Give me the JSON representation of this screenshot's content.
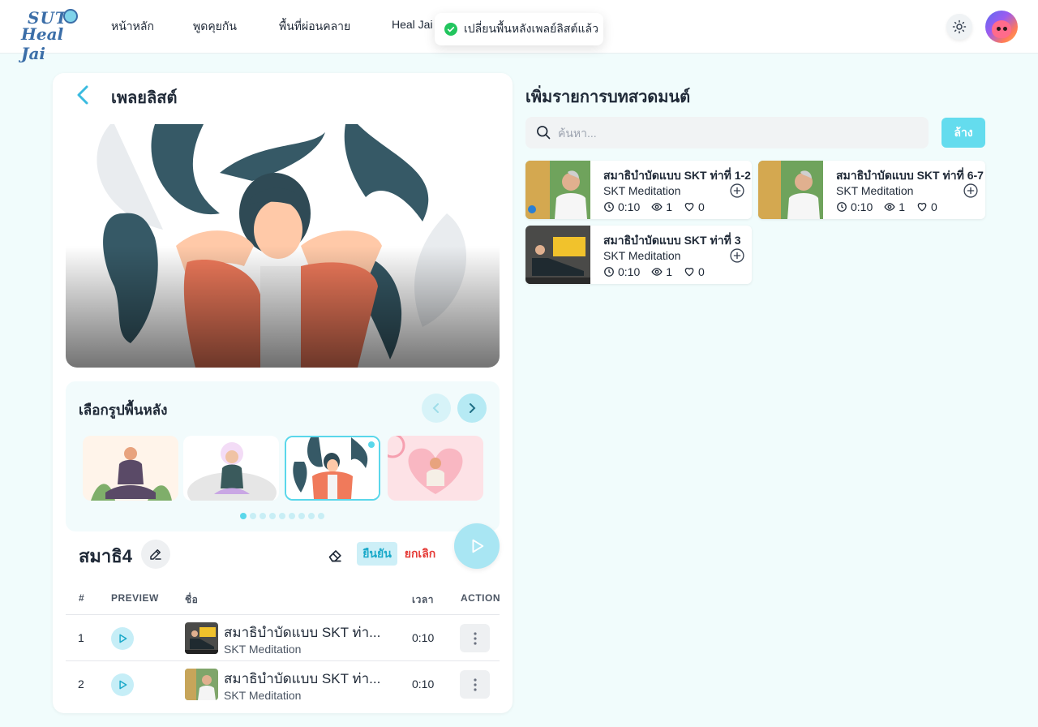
{
  "nav": {
    "logo_line1": "SUT",
    "logo_line2": "Heal Jai",
    "items": [
      {
        "label": "หน้าหลัก"
      },
      {
        "label": "พูดคุยกัน"
      },
      {
        "label": "พื้นที่ผ่อนคลาย"
      },
      {
        "label": "Heal Jai"
      }
    ]
  },
  "toast": {
    "message": "เปลี่ยนพื้นหลังเพลย์ลิสต์แล้ว"
  },
  "playlist": {
    "header_title": "เพลยลิสต์",
    "background_picker_title": "เลือกรูปพื้นหลัง",
    "background_thumbnail_count": 9,
    "selected_background_index": 2,
    "name": "สมาธิ4",
    "confirm_label": "ยืนยัน",
    "cancel_label": "ยกเลิก",
    "table": {
      "headers": [
        "#",
        "PREVIEW",
        "ชื่อ",
        "เวลา",
        "ACTION"
      ],
      "rows": [
        {
          "num": "1",
          "title": "สมาธิบำบัดแบบ SKT ท่า...",
          "subtitle": "SKT Meditation",
          "duration": "0:10"
        },
        {
          "num": "2",
          "title": "สมาธิบำบัดแบบ SKT ท่า...",
          "subtitle": "SKT Meditation",
          "duration": "0:10"
        }
      ]
    }
  },
  "add_panel": {
    "title": "เพิ่มรายการบทสวดมนต์",
    "search_placeholder": "ค้นหา...",
    "clear_label": "ล้าง",
    "videos": [
      {
        "title": "สมาธิบำบัดแบบ SKT ท่าที่ 1-2",
        "channel": "SKT Meditation",
        "duration": "0:10",
        "views": "1",
        "likes": "0"
      },
      {
        "title": "สมาธิบำบัดแบบ SKT ท่าที่ 6-7",
        "channel": "SKT Meditation",
        "duration": "0:10",
        "views": "1",
        "likes": "0"
      },
      {
        "title": "สมาธิบำบัดแบบ SKT ท่าที่ 3",
        "channel": "SKT Meditation",
        "duration": "0:10",
        "views": "1",
        "likes": "0"
      }
    ]
  },
  "colors": {
    "accent": "#5ad7ea",
    "danger": "#e53935",
    "background": "#f1fcfc"
  }
}
